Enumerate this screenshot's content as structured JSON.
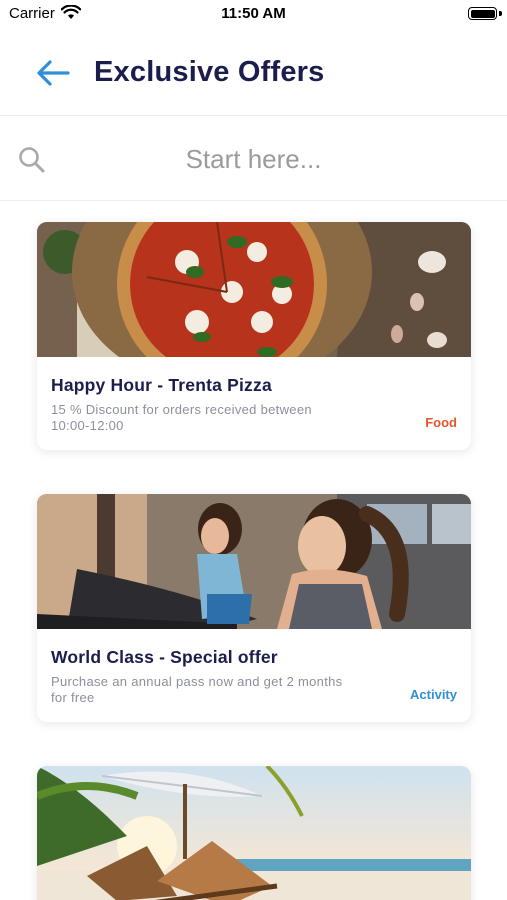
{
  "status_bar": {
    "carrier": "Carrier",
    "time": "11:50 AM",
    "wifi_icon": "wifi-icon",
    "battery_icon": "battery-icon"
  },
  "header": {
    "title": "Exclusive Offers",
    "back_icon": "arrow-left-icon",
    "back_icon_color": "#2f8fd8"
  },
  "search": {
    "placeholder": "Start here...",
    "value": "",
    "icon": "search-icon"
  },
  "offers": [
    {
      "title": "Happy Hour - Trenta Pizza",
      "description": "15 % Discount for orders received between 10:00-12:00",
      "category": "Food",
      "category_color": "#e5562c",
      "image": "pizza-photo"
    },
    {
      "title": "World Class - Special offer",
      "description": "Purchase an annual pass now and get 2 months for free",
      "category": "Activity",
      "category_color": "#2f8fd8",
      "image": "gym-treadmill-photo"
    },
    {
      "image": "beach-umbrella-photo"
    }
  ],
  "colors": {
    "title_text": "#1b1d4d",
    "secondary_text": "#8d8f9c",
    "divider": "#ececf0"
  }
}
